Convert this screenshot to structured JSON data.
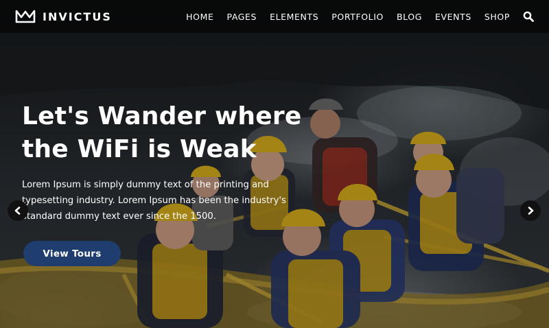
{
  "header": {
    "brand": {
      "name": "INVICTUS",
      "logo_icon": "brand-crown-logo"
    },
    "nav": [
      {
        "label": "HOME"
      },
      {
        "label": "PAGES"
      },
      {
        "label": "ELEMENTS"
      },
      {
        "label": "PORTFOLIO"
      },
      {
        "label": "BLOG"
      },
      {
        "label": "EVENTS"
      },
      {
        "label": "SHOP"
      }
    ],
    "search_icon": "search-icon"
  },
  "hero": {
    "headline": "Let's Wander where the WiFi is Weak",
    "description": "Lorem Ipsum is simply dummy text of the printing and typesetting industry. Lorem Ipsum has been the industry's standard dummy text ever since the 1500.",
    "cta_label": "View Tours",
    "background_image": "group whitewater rafting with yellow helmets and life jackets",
    "prev_icon": "chevron-left-icon",
    "next_icon": "chevron-right-icon"
  },
  "colors": {
    "cta_background": "#1f3d6e",
    "text": "#ffffff",
    "header_background": "rgba(0,0,0,0.55)",
    "arrow_background": "#111111",
    "helmet_yellow": "#e3b71c"
  }
}
